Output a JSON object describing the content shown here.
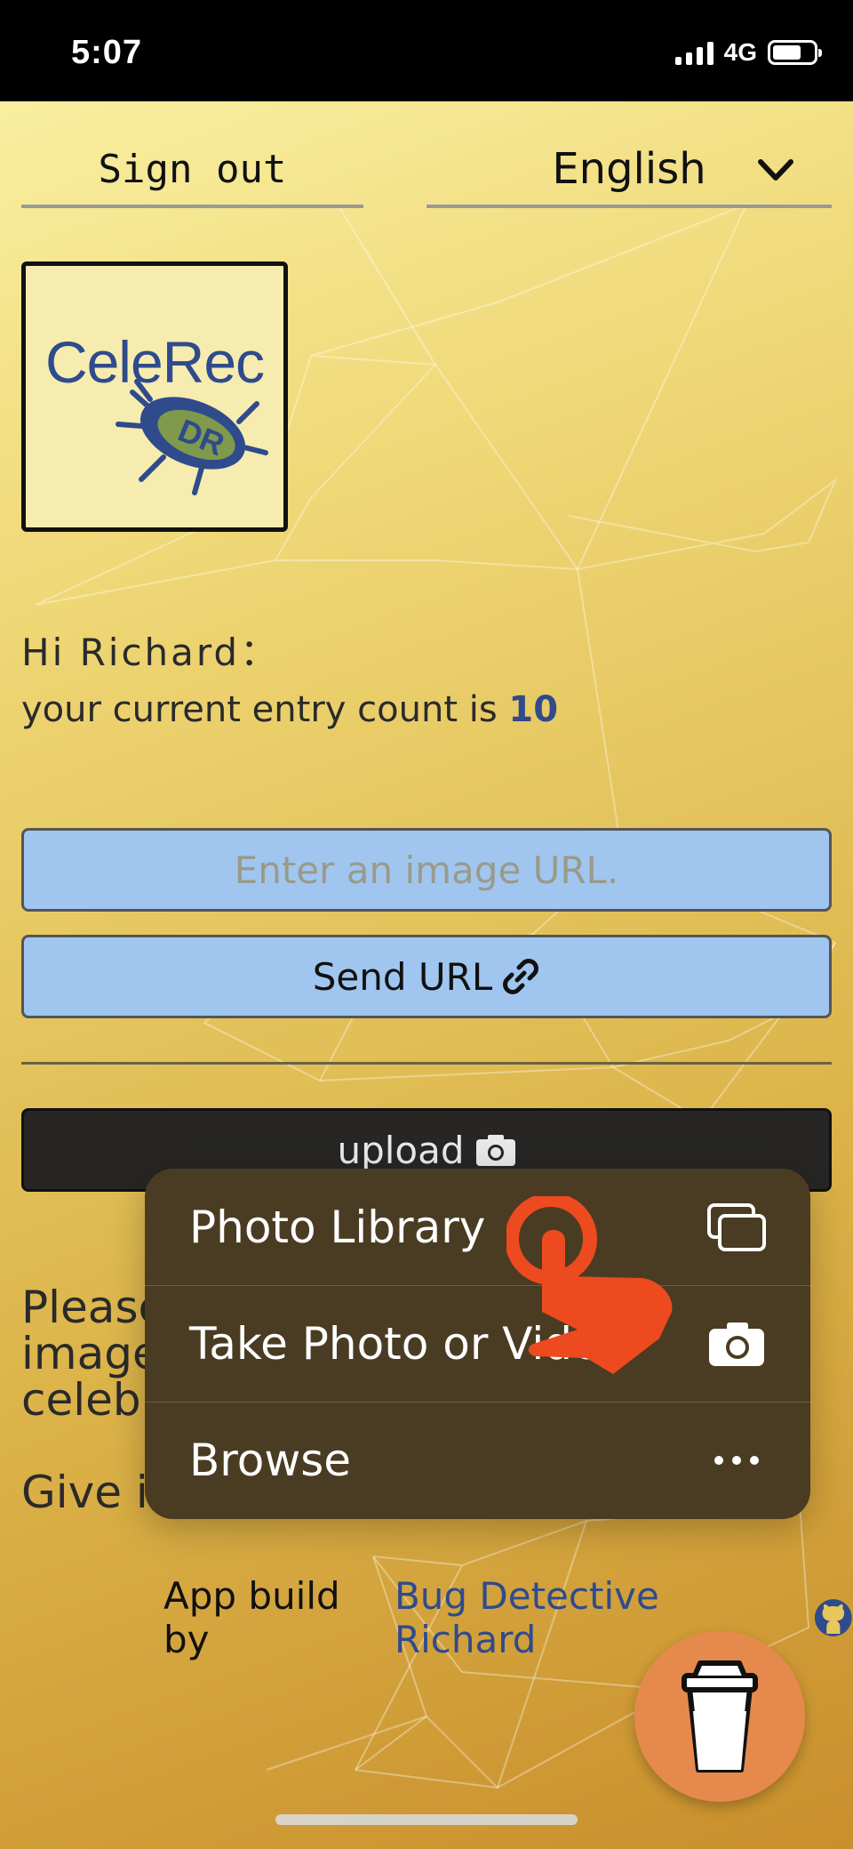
{
  "status_bar": {
    "time": "5:07",
    "network": "4G"
  },
  "header": {
    "sign_out_label": "Sign out",
    "language": {
      "selected": "English"
    }
  },
  "logo": {
    "text": "CeleRec"
  },
  "greeting": {
    "line1": "Hi Richard：",
    "entry_prefix": "your current entry count is ",
    "entry_count": "10"
  },
  "url_form": {
    "placeholder": "Enter an image URL.",
    "send_label": "Send URL"
  },
  "upload": {
    "label": "upload"
  },
  "partial_texts": [
    "Please",
    "image",
    "celebr",
    "Give it"
  ],
  "menu": {
    "items": [
      {
        "label": "Photo Library",
        "icon": "photo-library-icon"
      },
      {
        "label": "Take Photo or Vide",
        "icon": "camera-icon"
      },
      {
        "label": "Browse",
        "icon": "more-icon"
      }
    ]
  },
  "footer": {
    "prefix": "App build by ",
    "link_text": "Bug Detective Richard"
  },
  "colors": {
    "accent_blue": "#2f4b8c",
    "input_blue": "#a0c6f0",
    "menu_bg": "#4a3c22",
    "coffee": "#e58a4c",
    "tap": "#ee4a1f"
  }
}
